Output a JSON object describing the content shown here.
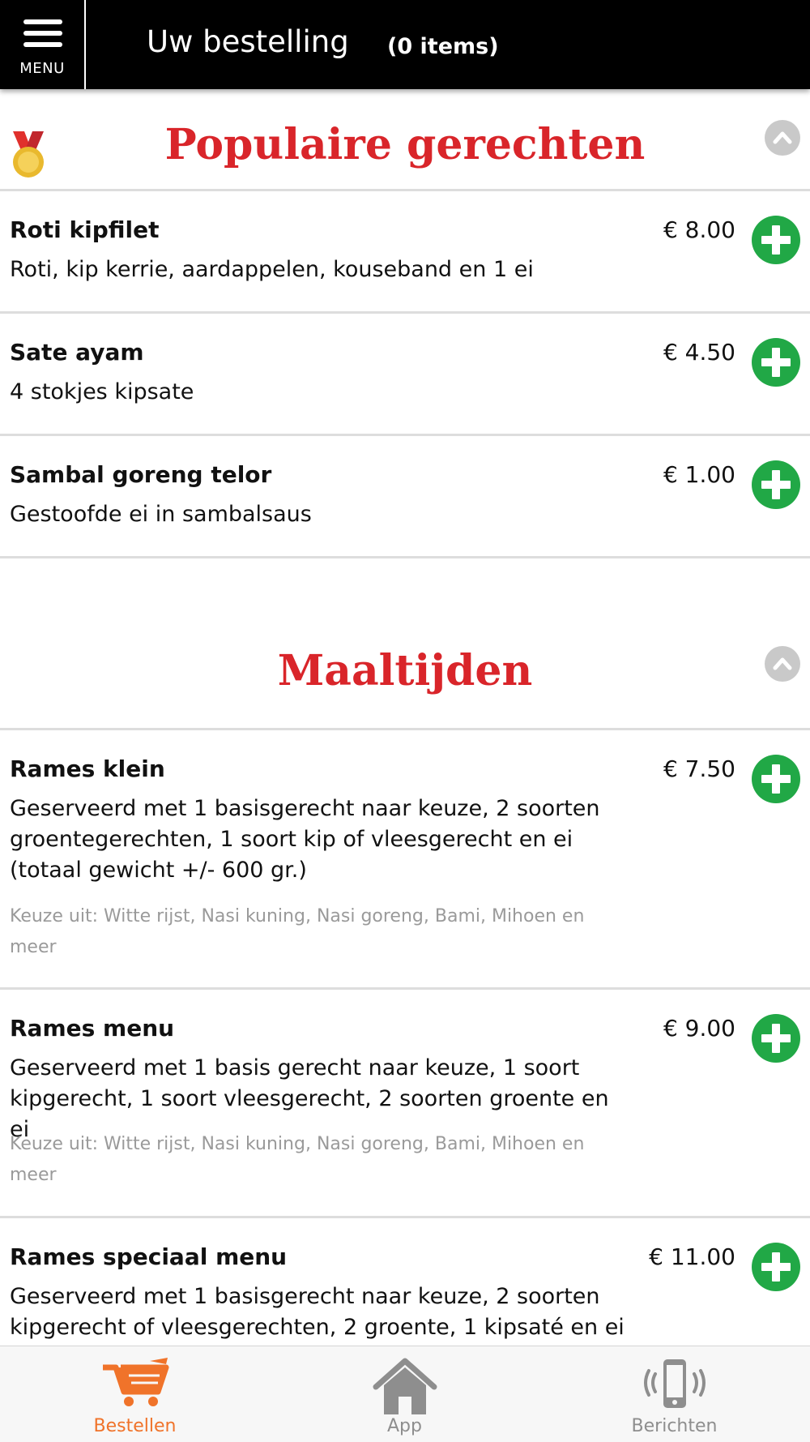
{
  "header": {
    "menu_label": "MENU",
    "title": "Uw bestelling",
    "item_count": "(0 items)"
  },
  "sections": [
    {
      "title": "Populaire gerechten",
      "icon": "medal-icon",
      "items": [
        {
          "name": "Roti kipfilet",
          "price": "€ 8.00",
          "description": "Roti, kip kerrie, aardappelen, kouseband en 1 ei"
        },
        {
          "name": "Sate ayam",
          "price": "€ 4.50",
          "description": "4 stokjes kipsate"
        },
        {
          "name": "Sambal goreng telor",
          "price": "€ 1.00",
          "description": "Gestoofde ei in sambalsaus"
        }
      ]
    },
    {
      "title": "Maaltijden",
      "items": [
        {
          "name": "Rames klein",
          "price": "€ 7.50",
          "description": "Geserveerd met 1 basisgerecht naar keuze, 2 soorten groentegerechten, 1 soort kip of vleesgerecht en ei (totaal gewicht +/- 600 gr.)",
          "note": "Keuze uit: Witte rijst, Nasi kuning, Nasi goreng, Bami, Mihoen en meer"
        },
        {
          "name": "Rames menu",
          "price": "€ 9.00",
          "description": "Geserveerd met 1 basis gerecht naar keuze, 1 soort kipgerecht, 1 soort vleesgerecht, 2 soorten groente en ei",
          "note": "Keuze uit: Witte rijst, Nasi kuning, Nasi goreng, Bami, Mihoen en meer"
        },
        {
          "name": "Rames speciaal menu",
          "price": "€ 11.00",
          "description": "Geserveerd met 1 basisgerecht naar keuze, 2 soorten kipgerecht of vleesgerechten, 2 groente, 1 kipsaté en ei"
        }
      ]
    }
  ],
  "bottom_nav": [
    {
      "label": "Bestellen",
      "icon": "cart-icon",
      "active": true
    },
    {
      "label": "App",
      "icon": "home-icon",
      "active": false
    },
    {
      "label": "Berichten",
      "icon": "phone-vibrate-icon",
      "active": false
    }
  ],
  "colors": {
    "section_title": "#d9252a",
    "add_button": "#21a846",
    "active_nav": "#f0732a",
    "header_bg": "#000000"
  }
}
